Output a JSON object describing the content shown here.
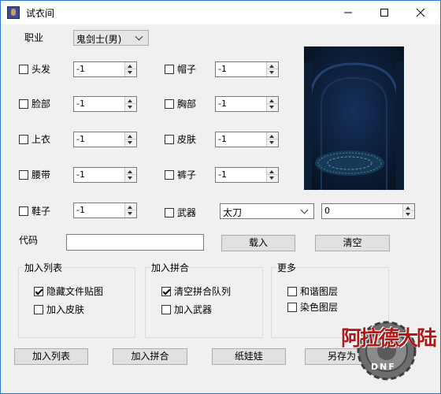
{
  "window": {
    "title": "试衣间"
  },
  "class_label": "职业",
  "class_value": "鬼剑士(男)",
  "slots": [
    {
      "label": "头发",
      "value": "-1"
    },
    {
      "label": "帽子",
      "value": "-1"
    },
    {
      "label": "脸部",
      "value": "-1"
    },
    {
      "label": "胸部",
      "value": "-1"
    },
    {
      "label": "上衣",
      "value": "-1"
    },
    {
      "label": "皮肤",
      "value": "-1"
    },
    {
      "label": "腰带",
      "value": "-1"
    },
    {
      "label": "裤子",
      "value": "-1"
    },
    {
      "label": "鞋子",
      "value": "-1"
    },
    {
      "label": "武器",
      "value": ""
    }
  ],
  "weapon_type": "太刀",
  "weapon_value": "0",
  "code_label": "代码",
  "code_value": "",
  "load_button": "载入",
  "clear_button": "清空",
  "groups": {
    "list": {
      "title": "加入列表",
      "options": [
        {
          "label": "隐藏文件贴图",
          "checked": true
        },
        {
          "label": "加入皮肤",
          "checked": false
        }
      ]
    },
    "merge": {
      "title": "加入拼合",
      "options": [
        {
          "label": "清空拼合队列",
          "checked": true
        },
        {
          "label": "加入武器",
          "checked": false
        }
      ]
    },
    "more": {
      "title": "更多",
      "options": [
        {
          "label": "和谐图层",
          "checked": false
        },
        {
          "label": "染色图层",
          "checked": false
        }
      ]
    }
  },
  "bottom_buttons": {
    "add_list": "加入列表",
    "add_merge": "加入拼合",
    "paper_doll": "纸娃娃",
    "save_as": "另存为"
  },
  "logo_text": "阿拉德大陆",
  "logo_sub": "DNF",
  "colors": {
    "titlebar": "#ffffff",
    "accent_border": "#2b78c8",
    "preview_bg": "#0c1a2e",
    "logo_red": "#b01818"
  }
}
